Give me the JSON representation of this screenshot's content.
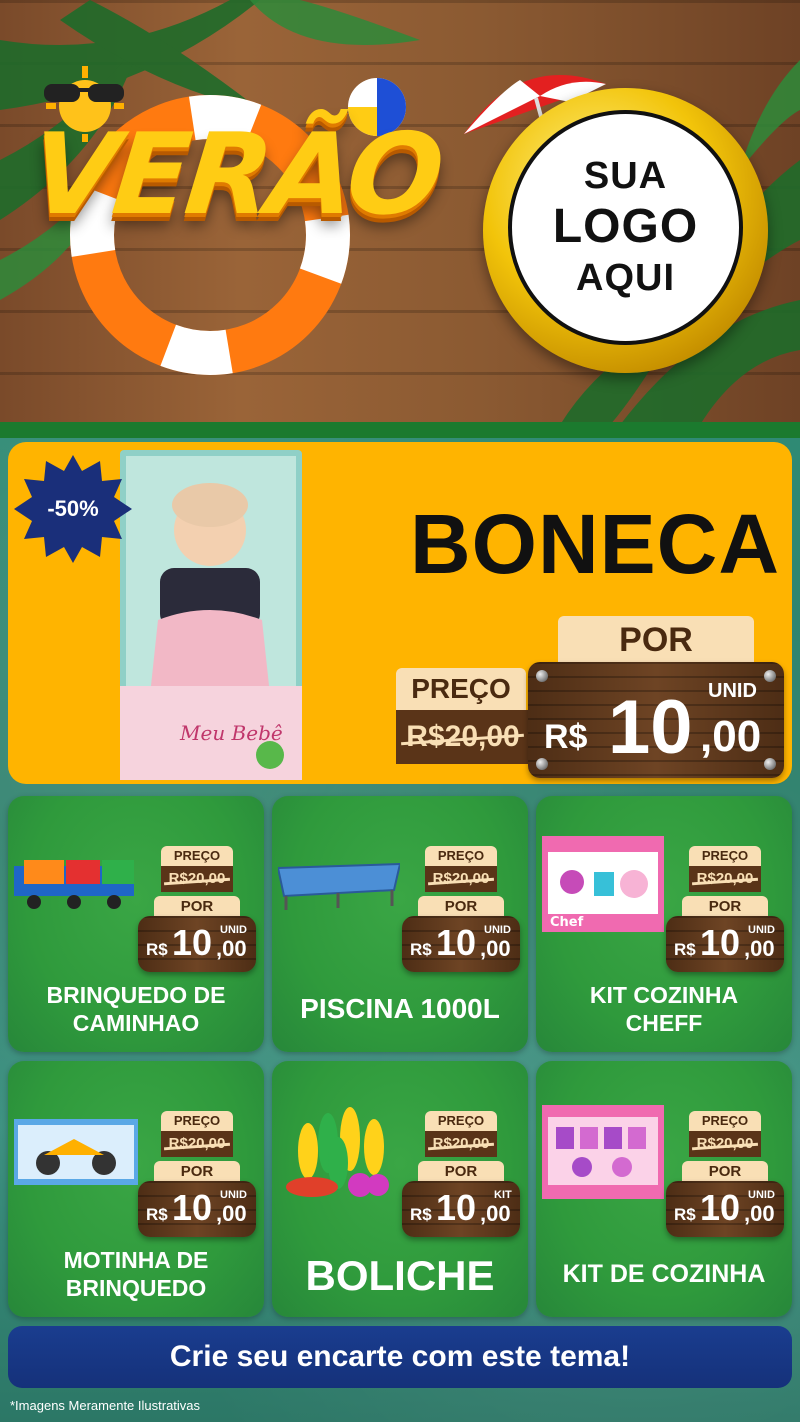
{
  "header": {
    "title": "VERÃO",
    "logo_lines": [
      "SUA",
      "LOGO",
      "AQUI"
    ]
  },
  "hero": {
    "discount": "-50%",
    "product_name": "BONECA",
    "preco_label": "PREÇO",
    "old_price": "R$20,00",
    "por_label": "POR",
    "unit": "UNID",
    "currency": "R$",
    "price_int": "10",
    "price_dec": ",00"
  },
  "cards": [
    {
      "name_lines": [
        "BRINQUEDO DE",
        "CAMINHAO"
      ],
      "preco_label": "PREÇO",
      "old_price": "R$20,00",
      "por_label": "POR",
      "unit": "UNID",
      "currency": "R$",
      "price_int": "10",
      "price_dec": ",00"
    },
    {
      "name_lines": [
        "PISCINA 1000L"
      ],
      "preco_label": "PREÇO",
      "old_price": "R$20,00",
      "por_label": "POR",
      "unit": "UNID",
      "currency": "R$",
      "price_int": "10",
      "price_dec": ",00"
    },
    {
      "name_lines": [
        "KIT COZINHA",
        "CHEFF"
      ],
      "preco_label": "PREÇO",
      "old_price": "R$20,00",
      "por_label": "POR",
      "unit": "UNID",
      "currency": "R$",
      "price_int": "10",
      "price_dec": ",00"
    },
    {
      "name_lines": [
        "MOTINHA DE",
        "BRINQUEDO"
      ],
      "preco_label": "PREÇO",
      "old_price": "R$20,00",
      "por_label": "POR",
      "unit": "UNID",
      "currency": "R$",
      "price_int": "10",
      "price_dec": ",00"
    },
    {
      "name_lines": [
        "BOLICHE"
      ],
      "preco_label": "PREÇO",
      "old_price": "R$20,00",
      "por_label": "POR",
      "unit": "KIT",
      "currency": "R$",
      "price_int": "10",
      "price_dec": ",00"
    },
    {
      "name_lines": [
        "KIT DE COZINHA"
      ],
      "preco_label": "PREÇO",
      "old_price": "R$20,00",
      "por_label": "POR",
      "unit": "UNID",
      "currency": "R$",
      "price_int": "10",
      "price_dec": ",00"
    }
  ],
  "footer": {
    "cta": "Crie seu encarte com este tema!",
    "disclaimer": "*Imagens Meramente Ilustrativas"
  },
  "colors": {
    "hero_bg": "#ffb400",
    "card_bg": "#2f9a3c",
    "cta_bg": "#1a3d8f",
    "wood": "#5a3418"
  }
}
